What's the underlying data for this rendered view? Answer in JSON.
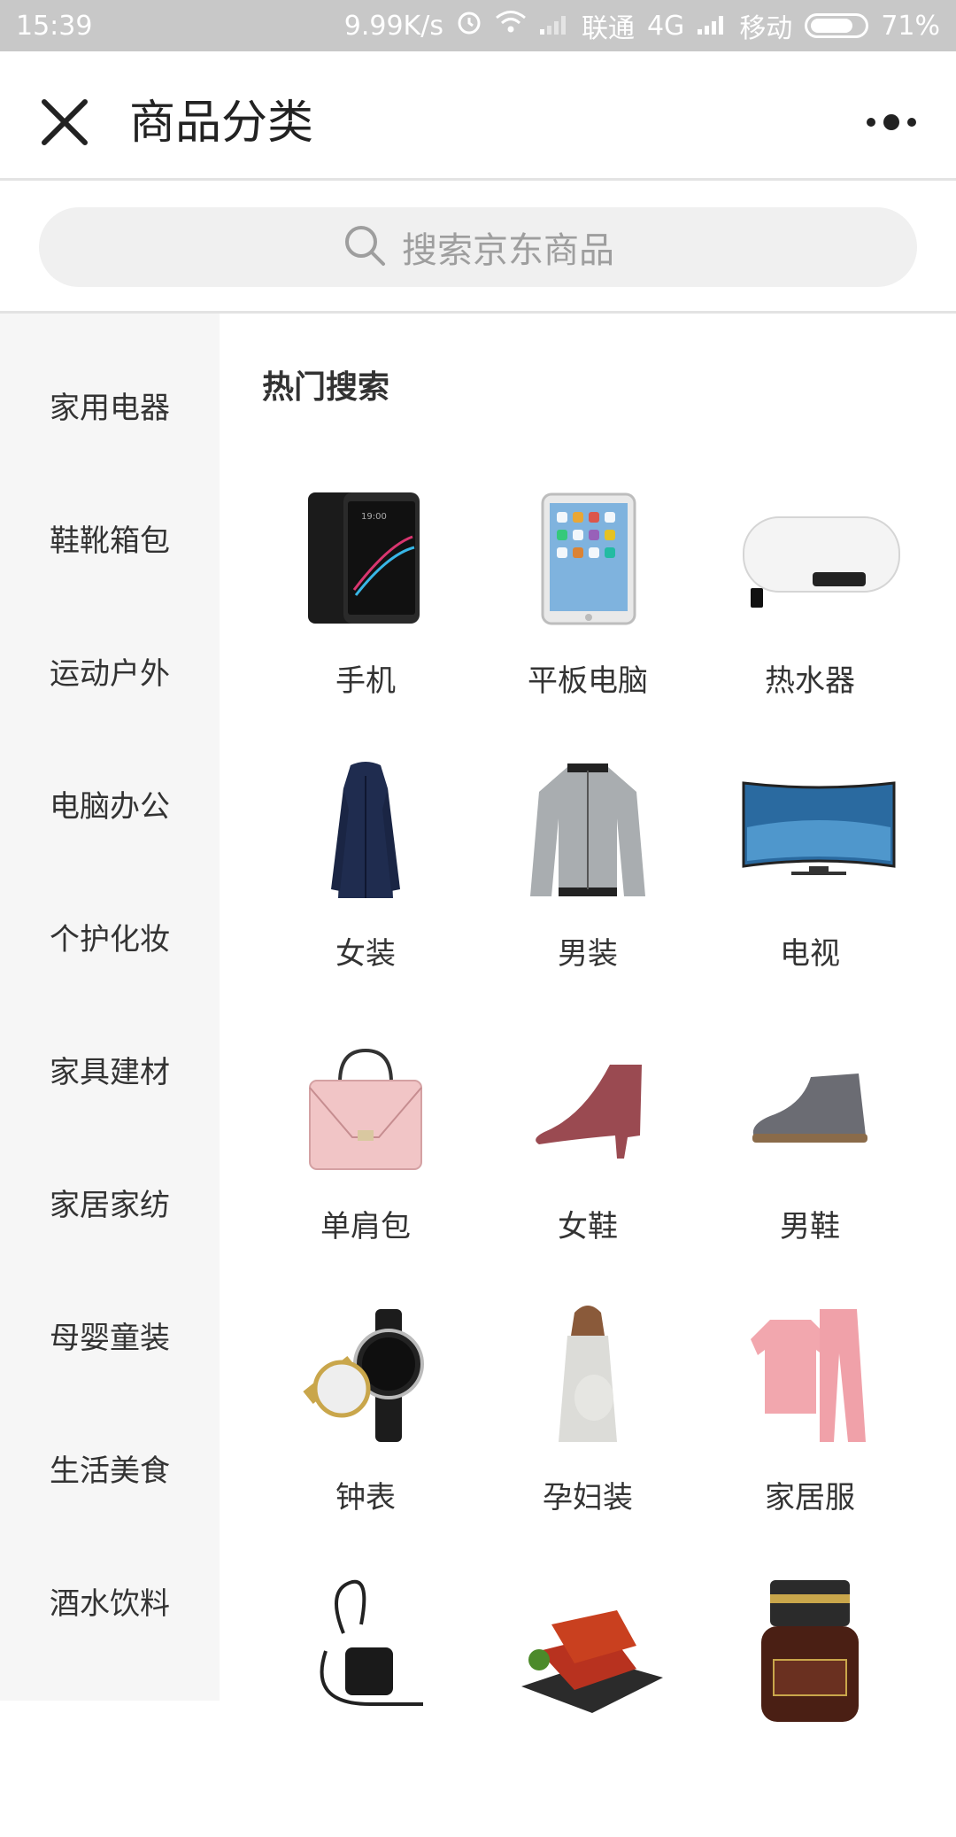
{
  "status_bar": {
    "time": "15:39",
    "speed": "9.99K/s",
    "carrier1": "联通",
    "network1": "4G",
    "carrier2": "移动",
    "battery": "71%"
  },
  "navbar": {
    "title": "商品分类",
    "close_icon": "close-icon",
    "more_icon": "more-icon"
  },
  "search": {
    "placeholder": "搜索京东商品",
    "icon": "search-icon"
  },
  "sidebar": {
    "items": [
      {
        "label": "家用电器"
      },
      {
        "label": "鞋靴箱包"
      },
      {
        "label": "运动户外"
      },
      {
        "label": "电脑办公"
      },
      {
        "label": "个护化妆"
      },
      {
        "label": "家具建材"
      },
      {
        "label": "家居家纺"
      },
      {
        "label": "母婴童装"
      },
      {
        "label": "生活美食"
      },
      {
        "label": "酒水饮料"
      }
    ]
  },
  "main": {
    "section_title": "热门搜索",
    "products": [
      {
        "label": "手机",
        "icon": "phone-image"
      },
      {
        "label": "平板电脑",
        "icon": "tablet-image"
      },
      {
        "label": "热水器",
        "icon": "water-heater-image"
      },
      {
        "label": "女装",
        "icon": "women-coat-image"
      },
      {
        "label": "男装",
        "icon": "men-jacket-image"
      },
      {
        "label": "电视",
        "icon": "tv-image"
      },
      {
        "label": "单肩包",
        "icon": "handbag-image"
      },
      {
        "label": "女鞋",
        "icon": "women-shoe-image"
      },
      {
        "label": "男鞋",
        "icon": "men-shoe-image"
      },
      {
        "label": "钟表",
        "icon": "watch-image"
      },
      {
        "label": "孕妇装",
        "icon": "maternity-image"
      },
      {
        "label": "家居服",
        "icon": "pajamas-image"
      },
      {
        "label": "",
        "icon": "headset-image"
      },
      {
        "label": "",
        "icon": "jerky-image"
      },
      {
        "label": "",
        "icon": "cosmetics-image"
      }
    ]
  },
  "colors": {
    "status_bg": "#c8c8c8",
    "sidebar_bg": "#f6f6f6",
    "search_bg": "#f0f0f0"
  }
}
